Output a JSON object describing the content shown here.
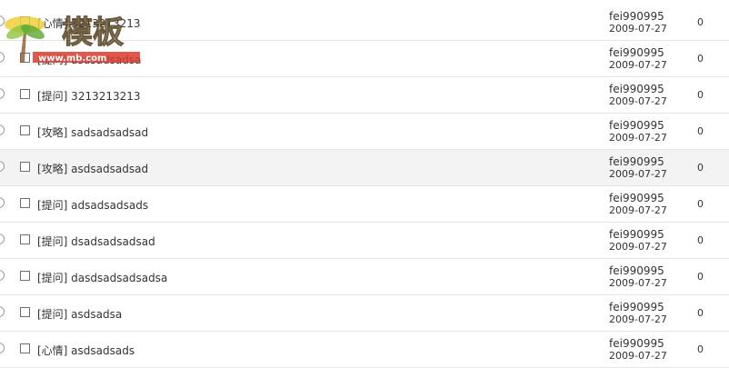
{
  "topics": [
    {
      "title": "[心情] 3213213213",
      "author": "fei990995",
      "date": "2009-07-27",
      "count": "0"
    },
    {
      "title": "[提问] asdsadsadsa",
      "author": "fei990995",
      "date": "2009-07-27",
      "count": "0"
    },
    {
      "title": "[提问] 3213213213",
      "author": "fei990995",
      "date": "2009-07-27",
      "count": "0"
    },
    {
      "title": "[攻略] sadsadsadsad",
      "author": "fei990995",
      "date": "2009-07-27",
      "count": "0"
    },
    {
      "title": "[攻略] asdsadsadsad",
      "author": "fei990995",
      "date": "2009-07-27",
      "count": "0"
    },
    {
      "title": "[提问] adsadsadsads",
      "author": "fei990995",
      "date": "2009-07-27",
      "count": "0"
    },
    {
      "title": "[提问] dsadsadsadsad",
      "author": "fei990995",
      "date": "2009-07-27",
      "count": "0"
    },
    {
      "title": "[提问] dasdsadsadsadsa",
      "author": "fei990995",
      "date": "2009-07-27",
      "count": "0"
    },
    {
      "title": "[提问] asdsadsa",
      "author": "fei990995",
      "date": "2009-07-27",
      "count": "0"
    },
    {
      "title": "[心情] asdsadsads",
      "author": "fei990995",
      "date": "2009-07-27",
      "count": "0"
    }
  ],
  "watermark": {
    "text": "模板",
    "url": "www.mb.com"
  },
  "colors": {
    "row_border": "#e6e6e6",
    "row_hover": "#f3f3f3",
    "text": "#333333"
  }
}
